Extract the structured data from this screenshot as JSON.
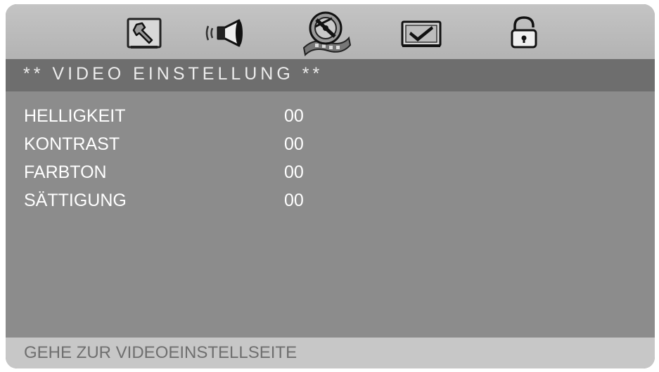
{
  "tabs": [
    {
      "icon": "setup-tools-icon",
      "active": false
    },
    {
      "icon": "speaker-audio-icon",
      "active": false
    },
    {
      "icon": "video-film-reel-icon",
      "active": true
    },
    {
      "icon": "preferences-checkmark-icon",
      "active": false
    },
    {
      "icon": "lock-password-icon",
      "active": false
    }
  ],
  "title": "** VIDEO EINSTELLUNG **",
  "settings": [
    {
      "label": "HELLIGKEIT",
      "value": "00"
    },
    {
      "label": "KONTRAST",
      "value": "00"
    },
    {
      "label": "FARBTON",
      "value": "00"
    },
    {
      "label": "SÄTTIGUNG",
      "value": "00"
    }
  ],
  "status": "GEHE ZUR VIDEOEINSTELLSEITE",
  "colors": {
    "panel": "#8c8c8c",
    "tabbar": "#bdbdbd",
    "title_bar": "#6e6e6e",
    "status_bar": "#c7c7c7",
    "text": "#ffffff"
  }
}
